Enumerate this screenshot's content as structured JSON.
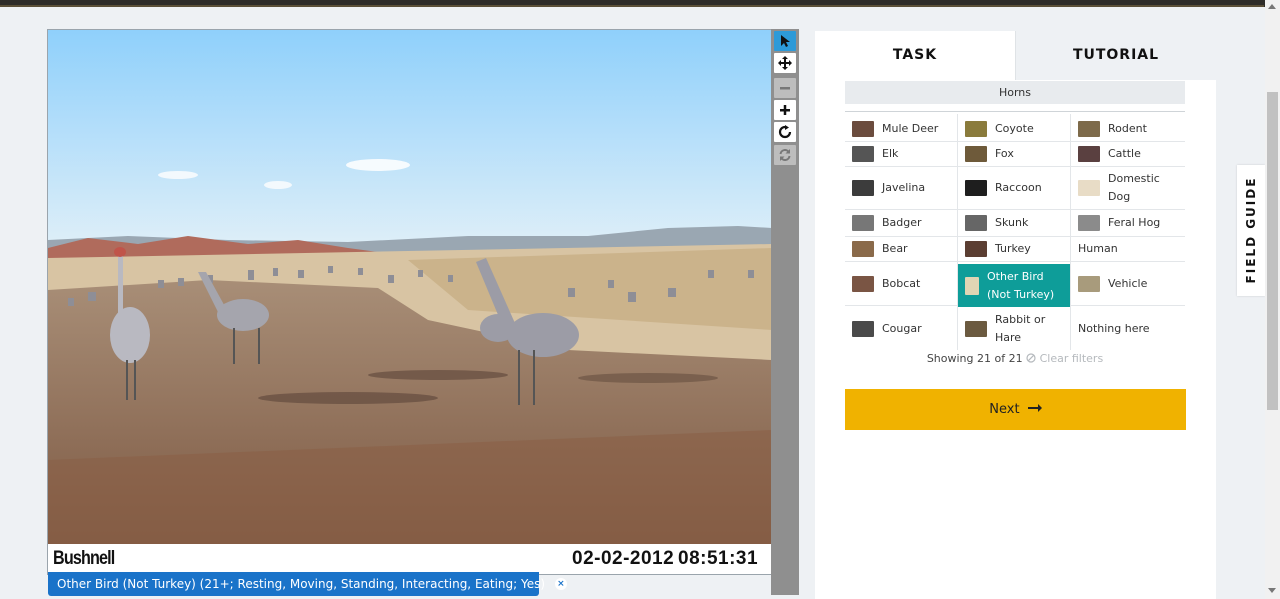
{
  "viewer": {
    "stamp_brand": "Bushnell",
    "stamp_date": "02-02-2012",
    "stamp_time": "08:51:31",
    "photo_alt": "sandhill cranes on dirt field"
  },
  "toolbar": {
    "tools": [
      "pointer-icon",
      "move-icon",
      "zoom-out-icon",
      "zoom-in-icon",
      "rotate-icon",
      "reset-icon"
    ]
  },
  "annotation": {
    "label": "Other Bird (Not Turkey) (21+; Resting, Moving, Standing, Interacting, Eating; Yes)",
    "close_glyph": "×"
  },
  "tabs": {
    "task": "TASK",
    "tutorial": "TUTORIAL"
  },
  "filter": {
    "horns": "Horns"
  },
  "species": [
    {
      "label": "Mule Deer"
    },
    {
      "label": "Coyote"
    },
    {
      "label": "Rodent"
    },
    {
      "label": "Elk"
    },
    {
      "label": "Fox"
    },
    {
      "label": "Cattle"
    },
    {
      "label": "Javelina"
    },
    {
      "label": "Raccoon"
    },
    {
      "label": "Domestic Dog"
    },
    {
      "label": "Badger"
    },
    {
      "label": "Skunk"
    },
    {
      "label": "Feral Hog"
    },
    {
      "label": "Bear"
    },
    {
      "label": "Turkey"
    },
    {
      "label": "Human"
    },
    {
      "label": "Bobcat"
    },
    {
      "label": "Other Bird (Not Turkey)"
    },
    {
      "label": "Vehicle"
    },
    {
      "label": "Cougar"
    },
    {
      "label": "Rabbit or Hare"
    },
    {
      "label": "Nothing here"
    }
  ],
  "showing": {
    "text": "Showing 21 of 21",
    "clear": "Clear filters"
  },
  "next": {
    "label": "Next"
  },
  "field_guide": {
    "label": "FIELD GUIDE"
  },
  "colors": {
    "selected": "#0e9d99",
    "next": "#f0b200",
    "tag": "#1a73c9",
    "active_tool": "#2d9ad8"
  }
}
